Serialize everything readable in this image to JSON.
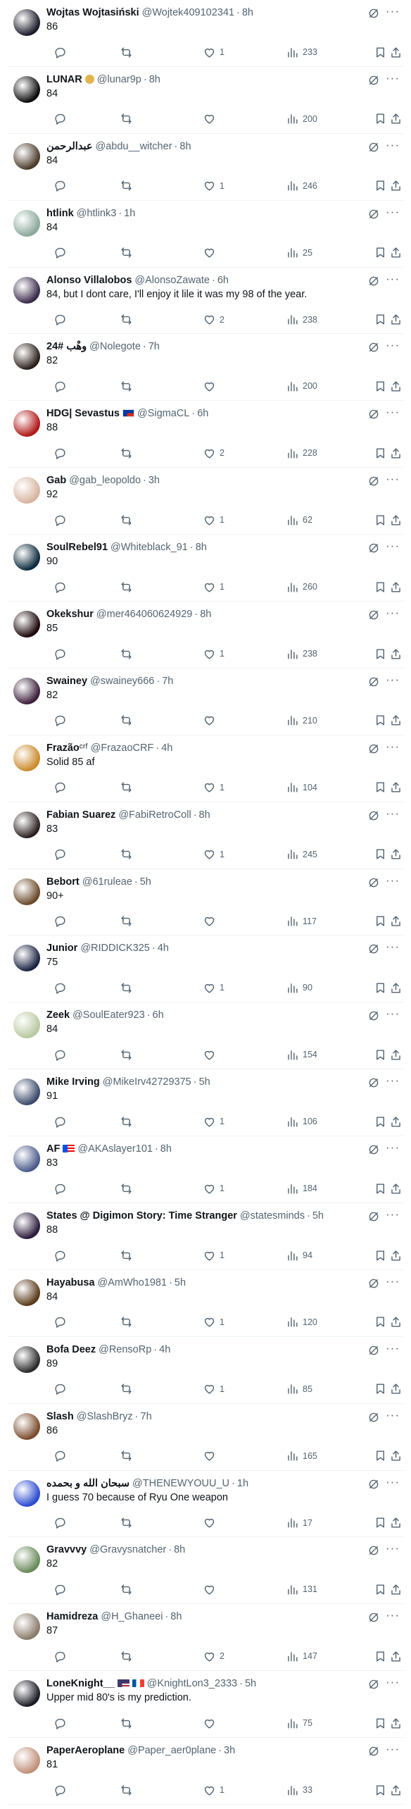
{
  "tweets": [
    {
      "name": "Wojtas Wojtasiński",
      "handle": "@Wojtek409102341",
      "time": "8h",
      "text": "86",
      "replies": "",
      "retweets": "",
      "likes": "1",
      "views": "233",
      "avatar_color": "#1b1b2a"
    },
    {
      "name": "LUNAR",
      "badge": "gold-badge",
      "handle": "@lunar9p",
      "time": "8h",
      "text": "84",
      "replies": "",
      "retweets": "",
      "likes": "",
      "views": "200",
      "avatar_color": "#0a0a0a"
    },
    {
      "name": "عبدالرحمن",
      "handle": "@abdu__witcher",
      "time": "8h",
      "text": "84",
      "replies": "",
      "retweets": "",
      "likes": "1",
      "views": "246",
      "avatar_color": "#4a3a2a"
    },
    {
      "name": "htlink",
      "handle": "@htlink3",
      "time": "1h",
      "text": "84",
      "replies": "",
      "retweets": "",
      "likes": "",
      "views": "25",
      "avatar_color": "#8aa89b"
    },
    {
      "name": "Alonso Villalobos",
      "handle": "@AlonsoZawate",
      "time": "6h",
      "text": "84, but I dont care, I'll enjoy it lile it was my 98 of the year.",
      "replies": "",
      "retweets": "",
      "likes": "2",
      "views": "238",
      "avatar_color": "#3a2a4a"
    },
    {
      "name": "وهْب #24",
      "handle": "@Nolegote",
      "time": "7h",
      "text": "82",
      "replies": "",
      "retweets": "",
      "likes": "",
      "views": "200",
      "avatar_color": "#2a1f1a"
    },
    {
      "name": "HDG| Sevastus",
      "flag": "cl",
      "handle": "@SigmaCL",
      "time": "6h",
      "text": "88",
      "replies": "",
      "retweets": "",
      "likes": "2",
      "views": "228",
      "avatar_color": "#b01818"
    },
    {
      "name": "Gab",
      "handle": "@gab_leopoldo",
      "time": "3h",
      "text": "92",
      "replies": "",
      "retweets": "",
      "likes": "1",
      "views": "62",
      "avatar_color": "#d8b4a0"
    },
    {
      "name": "SoulRebel91",
      "handle": "@Whiteblack_91",
      "time": "8h",
      "text": "90",
      "replies": "",
      "retweets": "",
      "likes": "1",
      "views": "260",
      "avatar_color": "#0b2a3c"
    },
    {
      "name": "Okekshur",
      "handle": "@mer464060624929",
      "time": "8h",
      "text": "85",
      "replies": "",
      "retweets": "",
      "likes": "1",
      "views": "238",
      "avatar_color": "#1a0508"
    },
    {
      "name": "Swainey",
      "handle": "@swainey666",
      "time": "7h",
      "text": "82",
      "replies": "",
      "retweets": "",
      "likes": "",
      "views": "210",
      "avatar_color": "#3b1f3a"
    },
    {
      "name": "Frazão",
      "name_suffix": "ᶜʳᶠ",
      "handle": "@FrazaoCRF",
      "time": "4h",
      "text": "Solid 85 af",
      "replies": "",
      "retweets": "",
      "likes": "1",
      "views": "104",
      "avatar_color": "#c98a2a"
    },
    {
      "name": "Fabian Suarez",
      "handle": "@FabiRetroColl",
      "time": "8h",
      "text": "83",
      "replies": "",
      "retweets": "",
      "likes": "1",
      "views": "245",
      "avatar_color": "#2a1e1e"
    },
    {
      "name": "Bebort",
      "handle": "@61ruleae",
      "time": "5h",
      "text": "90+",
      "replies": "",
      "retweets": "",
      "likes": "",
      "views": "117",
      "avatar_color": "#6b4a2a"
    },
    {
      "name": "Junior",
      "handle": "@RIDDICK325",
      "time": "4h",
      "text": "75",
      "replies": "",
      "retweets": "",
      "likes": "1",
      "views": "90",
      "avatar_color": "#1a2240"
    },
    {
      "name": "Zeek",
      "handle": "@SoulEater923",
      "time": "6h",
      "text": "84",
      "replies": "",
      "retweets": "",
      "likes": "",
      "views": "154",
      "avatar_color": "#b8c8a0"
    },
    {
      "name": "Mike Irving",
      "handle": "@MikeIrv42729375",
      "time": "5h",
      "text": "91",
      "replies": "",
      "retweets": "",
      "likes": "1",
      "views": "106",
      "avatar_color": "#3a4a6a"
    },
    {
      "name": "AF",
      "flag": "pr",
      "handle": "@AKAslayer101",
      "time": "8h",
      "text": "83",
      "replies": "",
      "retweets": "",
      "likes": "1",
      "views": "184",
      "avatar_color": "#4a5a8a"
    },
    {
      "name": "States @ Digimon Story: Time Stranger",
      "handle": "@statesminds",
      "time": "5h",
      "text": "88",
      "replies": "",
      "retweets": "",
      "likes": "1",
      "views": "94",
      "avatar_color": "#2a1a3a"
    },
    {
      "name": "Hayabusa",
      "handle": "@AmWho1981",
      "time": "5h",
      "text": "84",
      "replies": "",
      "retweets": "",
      "likes": "1",
      "views": "120",
      "avatar_color": "#5a3a1a"
    },
    {
      "name": "Bofa Deez",
      "handle": "@RensoRp",
      "time": "4h",
      "text": "89",
      "replies": "",
      "retweets": "",
      "likes": "1",
      "views": "85",
      "avatar_color": "#2a2a2a"
    },
    {
      "name": "Slash",
      "handle": "@SlashBryz",
      "time": "7h",
      "text": "86",
      "replies": "",
      "retweets": "",
      "likes": "",
      "views": "165",
      "avatar_color": "#7a4a2a"
    },
    {
      "name": "سبحان الله و بحمده",
      "handle": "@THENEWYOUU_U",
      "time": "1h",
      "text": "I guess 70 because of Ryu One weapon",
      "replies": "",
      "retweets": "",
      "likes": "",
      "views": "17",
      "avatar_color": "#2a4ad0"
    },
    {
      "name": "Gravvvy",
      "handle": "@Gravysnatcher",
      "time": "8h",
      "text": "82",
      "replies": "",
      "retweets": "",
      "likes": "",
      "views": "131",
      "avatar_color": "#6a8a5a"
    },
    {
      "name": "Hamidreza",
      "handle": "@H_Ghaneei",
      "time": "8h",
      "text": "87",
      "replies": "",
      "retweets": "",
      "likes": "2",
      "views": "147",
      "avatar_color": "#8a7a6a"
    },
    {
      "name": "LoneKnight__",
      "flags": [
        "us",
        "fr"
      ],
      "handle": "@KnightLon3_2333",
      "time": "5h",
      "text": "Upper mid 80's is my prediction.",
      "replies": "",
      "retweets": "",
      "likes": "",
      "views": "75",
      "avatar_color": "#1a1a24"
    },
    {
      "name": "PaperAeroplane",
      "handle": "@Paper_aer0plane",
      "time": "3h",
      "text": "81",
      "replies": "",
      "retweets": "",
      "likes": "1",
      "views": "33",
      "avatar_color": "#c0907a"
    }
  ],
  "icons": {
    "reply": "reply-icon",
    "retweet": "retweet-icon",
    "like": "heart-icon",
    "views": "views-icon",
    "bookmark": "bookmark-icon",
    "share": "share-icon",
    "grok": "grok-icon",
    "more": "more-icon"
  },
  "more_glyph": "···",
  "colors": {
    "text": "#0f1419",
    "muted": "#536471",
    "divider": "#eff3f4",
    "background": "#ffffff"
  }
}
